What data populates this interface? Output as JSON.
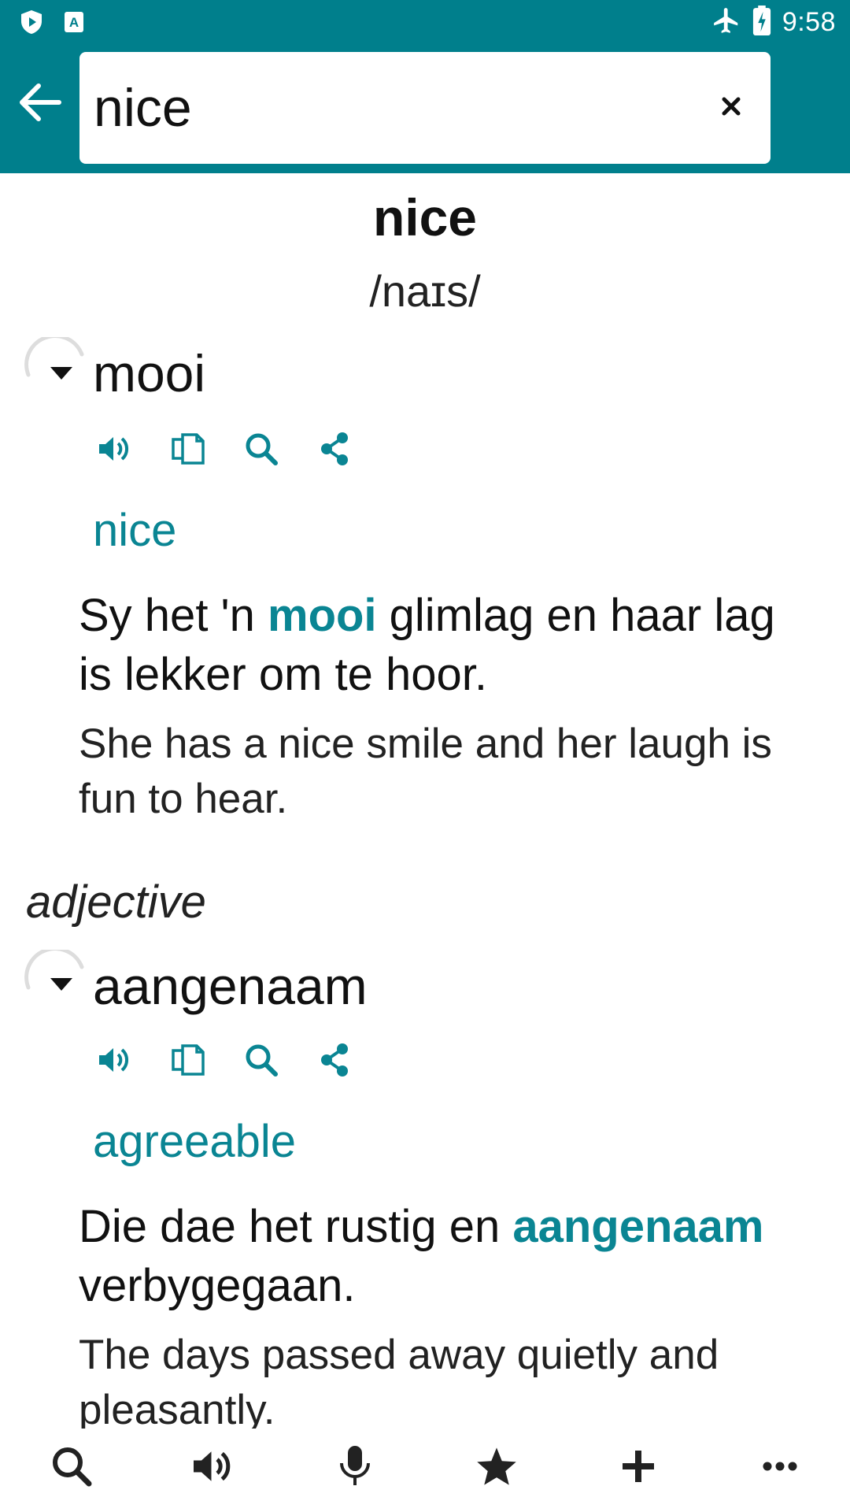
{
  "status_bar": {
    "time": "9:58",
    "left_icons": [
      "shield-play-icon",
      "a-badge-icon"
    ],
    "right_icons": [
      "airplane-icon",
      "battery-charging-icon"
    ]
  },
  "search": {
    "value": "nice",
    "back_icon": "arrow-left-icon",
    "clear_icon": "close-icon"
  },
  "headword": "nice",
  "phonetic": "/naɪs/",
  "entries": [
    {
      "word": "mooi",
      "translation": "nice",
      "example_before": "Sy het 'n ",
      "example_highlight": "mooi",
      "example_after": " glimlag en haar lag is lekker om te hoor.",
      "example_translation": "She has a nice smile and her laugh is fun to hear."
    },
    {
      "word": "aangenaam",
      "translation": "agreeable",
      "example_before": "Die dae het rustig en ",
      "example_highlight": "aangenaam",
      "example_after": " verbygegaan.",
      "example_translation": "The days passed away quietly and pleasantly."
    }
  ],
  "part_of_speech": "adjective",
  "entry_actions": [
    "speaker-icon",
    "copy-icon",
    "search-icon",
    "share-icon"
  ],
  "bottom_nav": [
    "search-icon",
    "speaker-icon",
    "microphone-icon",
    "star-icon",
    "plus-icon",
    "more-icon"
  ],
  "colors": {
    "header": "#007f8c",
    "accent": "#0a8593",
    "text": "#111111"
  }
}
